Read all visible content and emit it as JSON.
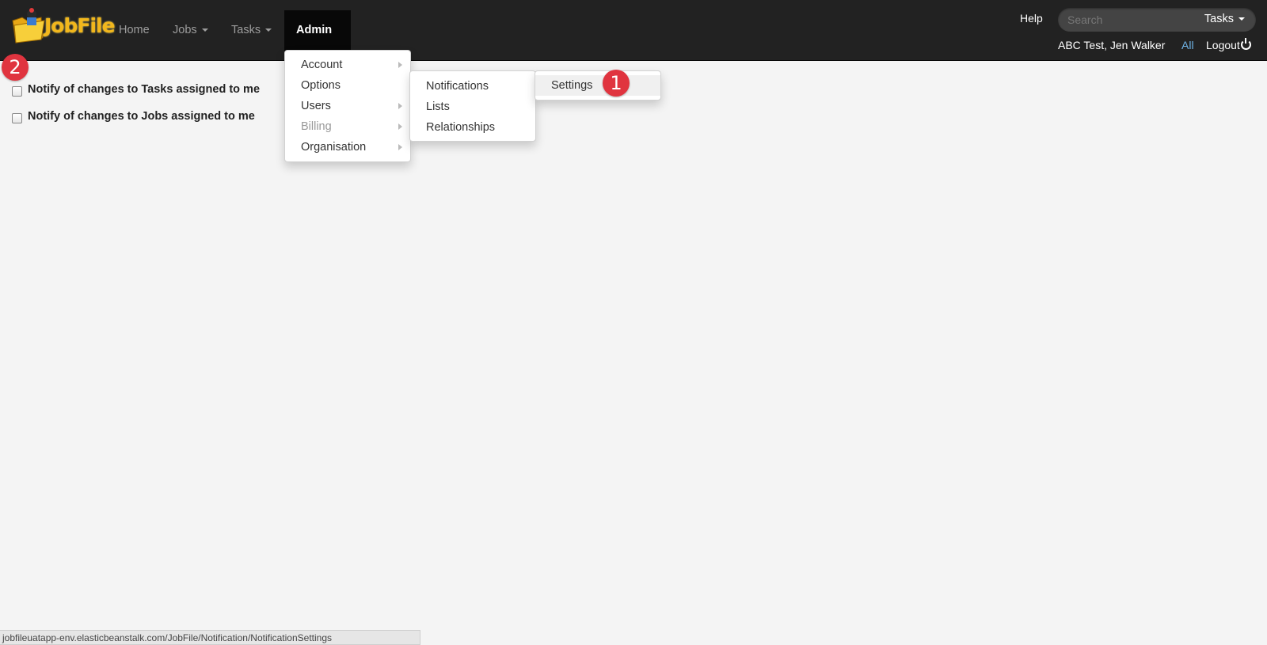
{
  "app": {
    "brand": "JobFile"
  },
  "nav": {
    "home": "Home",
    "jobs": "Jobs",
    "tasks": "Tasks",
    "admin": "Admin"
  },
  "header": {
    "help": "Help",
    "search_placeholder": "Search",
    "search_scope": "Tasks",
    "user": "ABC Test, Jen Walker",
    "all": "All",
    "logout": "Logout"
  },
  "admin_menu": {
    "items": [
      "Account",
      "Options",
      "Users",
      "Billing",
      "Organisation"
    ]
  },
  "options_menu": {
    "items": [
      "Notifications",
      "Lists",
      "Relationships"
    ]
  },
  "notifications_menu": {
    "items": [
      "Settings"
    ]
  },
  "badges": [
    "1",
    "2"
  ],
  "settings": {
    "tasks_label": "Notify of changes to Tasks assigned to me",
    "jobs_label": "Notify of changes to Jobs assigned to me",
    "tasks_checked": false,
    "jobs_checked": false
  },
  "status_url": "jobfileuatapp-env.elasticbeanstalk.com/JobFile/Notification/NotificationSettings",
  "colors": {
    "navbar": "#222222",
    "badge": "#e0343f",
    "brand": "#f2b71c"
  }
}
